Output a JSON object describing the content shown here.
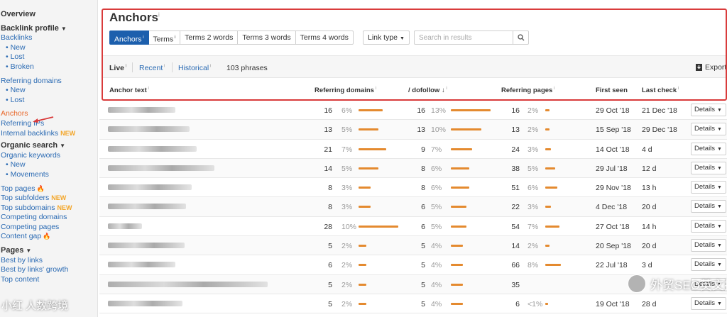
{
  "sidebar": {
    "overview": "Overview",
    "backlink_profile": "Backlink profile",
    "backlinks": "Backlinks",
    "backlinks_new": "New",
    "backlinks_lost": "Lost",
    "backlinks_broken": "Broken",
    "referring_domains": "Referring domains",
    "rd_new": "New",
    "rd_lost": "Lost",
    "anchors": "Anchors",
    "referring_ips": "Referring IPs",
    "internal_backlinks": "Internal backlinks",
    "new_badge": "NEW",
    "organic_search": "Organic search",
    "organic_keywords": "Organic keywords",
    "ok_new": "New",
    "ok_movements": "Movements",
    "top_pages": "Top pages",
    "top_subfolders": "Top subfolders",
    "top_subdomains": "Top subdomains",
    "competing_domains": "Competing domains",
    "competing_pages": "Competing pages",
    "content_gap": "Content gap",
    "pages": "Pages",
    "best_by_links": "Best by links",
    "best_by_links_growth": "Best by links' growth",
    "top_content": "Top content"
  },
  "header": {
    "title": "Anchors",
    "tabs": [
      "Anchors",
      "Terms",
      "Terms 2 words",
      "Terms 3 words",
      "Terms 4 words"
    ],
    "link_type": "Link type",
    "search_placeholder": "Search in results",
    "export": "Export"
  },
  "subbar": {
    "live": "Live",
    "recent": "Recent",
    "historical": "Historical",
    "count": "103 phrases"
  },
  "columns": {
    "anchor": "Anchor text",
    "rd": "Referring domains",
    "dofollow": "/ dofollow",
    "rp": "Referring pages",
    "first_seen": "First seen",
    "last_check": "Last check"
  },
  "rows": [
    {
      "rd": "16",
      "rd_pct": "6%",
      "rd_frac": 0.06,
      "df": "16",
      "df_pct": "13%",
      "df_frac": 0.13,
      "rp": "16",
      "rp_pct": "2%",
      "rp_frac": 0.02,
      "first": "29 Oct '18",
      "last": "21 Dec '18"
    },
    {
      "rd": "13",
      "rd_pct": "5%",
      "rd_frac": 0.05,
      "df": "13",
      "df_pct": "10%",
      "df_frac": 0.1,
      "rp": "13",
      "rp_pct": "2%",
      "rp_frac": 0.02,
      "first": "15 Sep '18",
      "last": "29 Dec '18"
    },
    {
      "rd": "21",
      "rd_pct": "7%",
      "rd_frac": 0.07,
      "df": "9",
      "df_pct": "7%",
      "df_frac": 0.07,
      "rp": "24",
      "rp_pct": "3%",
      "rp_frac": 0.03,
      "first": "14 Oct '18",
      "last": "4 d"
    },
    {
      "rd": "14",
      "rd_pct": "5%",
      "rd_frac": 0.05,
      "df": "8",
      "df_pct": "6%",
      "df_frac": 0.06,
      "rp": "38",
      "rp_pct": "5%",
      "rp_frac": 0.05,
      "first": "29 Jul '18",
      "last": "12 d"
    },
    {
      "rd": "8",
      "rd_pct": "3%",
      "rd_frac": 0.03,
      "df": "8",
      "df_pct": "6%",
      "df_frac": 0.06,
      "rp": "51",
      "rp_pct": "6%",
      "rp_frac": 0.06,
      "first": "29 Nov '18",
      "last": "13 h"
    },
    {
      "rd": "8",
      "rd_pct": "3%",
      "rd_frac": 0.03,
      "df": "6",
      "df_pct": "5%",
      "df_frac": 0.05,
      "rp": "22",
      "rp_pct": "3%",
      "rp_frac": 0.03,
      "first": "4 Dec '18",
      "last": "20 d"
    },
    {
      "rd": "28",
      "rd_pct": "10%",
      "rd_frac": 0.1,
      "df": "6",
      "df_pct": "5%",
      "df_frac": 0.05,
      "rp": "54",
      "rp_pct": "7%",
      "rp_frac": 0.07,
      "first": "27 Oct '18",
      "last": "14 h"
    },
    {
      "rd": "5",
      "rd_pct": "2%",
      "rd_frac": 0.02,
      "df": "5",
      "df_pct": "4%",
      "df_frac": 0.04,
      "rp": "14",
      "rp_pct": "2%",
      "rp_frac": 0.02,
      "first": "20 Sep '18",
      "last": "20 d"
    },
    {
      "rd": "6",
      "rd_pct": "2%",
      "rd_frac": 0.02,
      "df": "5",
      "df_pct": "4%",
      "df_frac": 0.04,
      "rp": "66",
      "rp_pct": "8%",
      "rp_frac": 0.08,
      "first": "22 Jul '18",
      "last": "3 d"
    },
    {
      "rd": "5",
      "rd_pct": "2%",
      "rd_frac": 0.02,
      "df": "5",
      "df_pct": "4%",
      "df_frac": 0.04,
      "rp": "35",
      "rp_pct": "",
      "rp_frac": 0.0,
      "first": "",
      "last": ""
    },
    {
      "rd": "5",
      "rd_pct": "2%",
      "rd_frac": 0.02,
      "df": "5",
      "df_pct": "4%",
      "df_frac": 0.04,
      "rp": "6",
      "rp_pct": "<1%",
      "rp_frac": 0.01,
      "first": "19 Oct '18",
      "last": "28 d"
    }
  ],
  "details_label": "Details",
  "watermark": {
    "main": "外贸SEO英文推广",
    "corner": "小红  人数跨境"
  },
  "colors": {
    "accent": "#1c5fad",
    "bar": "#e48a2f",
    "highlight": "#d93b3b"
  }
}
